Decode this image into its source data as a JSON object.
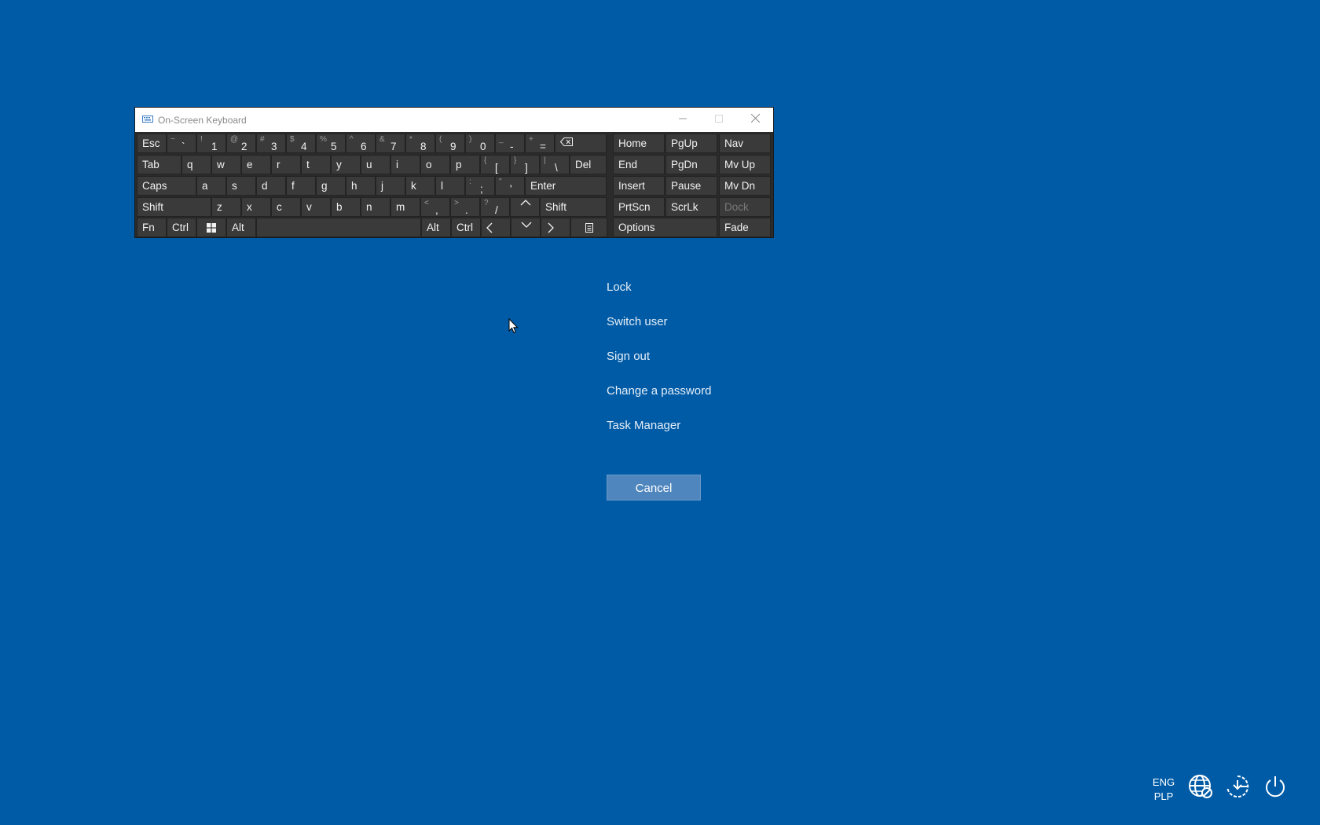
{
  "osk": {
    "title": "On-Screen Keyboard",
    "title_icon": "keyboard-icon",
    "controls": [
      "minimize-icon",
      "maximize-icon",
      "close-icon"
    ],
    "rows": [
      [
        {
          "id": "esc",
          "label": "Esc"
        },
        {
          "id": "tilde",
          "shift": "~",
          "base": "`"
        },
        {
          "id": "1",
          "shift": "!",
          "base": "1"
        },
        {
          "id": "2",
          "shift": "@",
          "base": "2"
        },
        {
          "id": "3",
          "shift": "#",
          "base": "3"
        },
        {
          "id": "4",
          "shift": "$",
          "base": "4"
        },
        {
          "id": "5",
          "shift": "%",
          "base": "5"
        },
        {
          "id": "6",
          "shift": "^",
          "base": "6"
        },
        {
          "id": "7",
          "shift": "&",
          "base": "7"
        },
        {
          "id": "8",
          "shift": "*",
          "base": "8"
        },
        {
          "id": "9",
          "shift": "(",
          "base": "9"
        },
        {
          "id": "0",
          "shift": ")",
          "base": "0"
        },
        {
          "id": "minus",
          "shift": "_",
          "base": "-"
        },
        {
          "id": "equals",
          "shift": "+",
          "base": "="
        },
        {
          "id": "backspace",
          "icon": "backspace-icon"
        }
      ],
      [
        {
          "id": "tab",
          "label": "Tab"
        },
        {
          "id": "q",
          "label": "q"
        },
        {
          "id": "w",
          "label": "w"
        },
        {
          "id": "e",
          "label": "e"
        },
        {
          "id": "r",
          "label": "r"
        },
        {
          "id": "t",
          "label": "t"
        },
        {
          "id": "y",
          "label": "y"
        },
        {
          "id": "u",
          "label": "u"
        },
        {
          "id": "i",
          "label": "i"
        },
        {
          "id": "o",
          "label": "o"
        },
        {
          "id": "p",
          "label": "p"
        },
        {
          "id": "lbracket",
          "shift": "{",
          "base": "["
        },
        {
          "id": "rbracket",
          "shift": "}",
          "base": "]"
        },
        {
          "id": "backslash",
          "shift": "|",
          "base": "\\"
        },
        {
          "id": "del",
          "label": "Del"
        }
      ],
      [
        {
          "id": "caps",
          "label": "Caps"
        },
        {
          "id": "a",
          "label": "a"
        },
        {
          "id": "s",
          "label": "s"
        },
        {
          "id": "d",
          "label": "d"
        },
        {
          "id": "f",
          "label": "f"
        },
        {
          "id": "g",
          "label": "g"
        },
        {
          "id": "h",
          "label": "h"
        },
        {
          "id": "j",
          "label": "j"
        },
        {
          "id": "k",
          "label": "k"
        },
        {
          "id": "l",
          "label": "l"
        },
        {
          "id": "semicolon",
          "shift": ":",
          "base": ";"
        },
        {
          "id": "quote",
          "shift": "\"",
          "base": "'"
        },
        {
          "id": "enter",
          "label": "Enter"
        }
      ],
      [
        {
          "id": "lshift",
          "label": "Shift"
        },
        {
          "id": "z",
          "label": "z"
        },
        {
          "id": "x",
          "label": "x"
        },
        {
          "id": "c",
          "label": "c"
        },
        {
          "id": "v",
          "label": "v"
        },
        {
          "id": "b",
          "label": "b"
        },
        {
          "id": "n",
          "label": "n"
        },
        {
          "id": "m",
          "label": "m"
        },
        {
          "id": "comma",
          "shift": "<",
          "base": ","
        },
        {
          "id": "period",
          "shift": ">",
          "base": "."
        },
        {
          "id": "slash",
          "shift": "?",
          "base": "/"
        },
        {
          "id": "up",
          "icon": "chevron-up-icon"
        },
        {
          "id": "rshift",
          "label": "Shift"
        }
      ],
      [
        {
          "id": "fn",
          "label": "Fn"
        },
        {
          "id": "lctrl",
          "label": "Ctrl"
        },
        {
          "id": "win",
          "icon": "windows-logo-icon"
        },
        {
          "id": "lalt",
          "label": "Alt"
        },
        {
          "id": "space",
          "label": ""
        },
        {
          "id": "ralt",
          "label": "Alt"
        },
        {
          "id": "rctrl",
          "label": "Ctrl"
        },
        {
          "id": "left",
          "icon": "chevron-left-icon"
        },
        {
          "id": "down",
          "icon": "chevron-down-icon"
        },
        {
          "id": "right",
          "icon": "chevron-right-icon"
        },
        {
          "id": "menu",
          "icon": "context-menu-icon"
        }
      ]
    ],
    "nav_rows": [
      [
        {
          "id": "home",
          "label": "Home"
        },
        {
          "id": "pgup",
          "label": "PgUp"
        },
        {
          "id": "nav",
          "label": "Nav"
        }
      ],
      [
        {
          "id": "end",
          "label": "End"
        },
        {
          "id": "pgdn",
          "label": "PgDn"
        },
        {
          "id": "mvup",
          "label": "Mv Up"
        }
      ],
      [
        {
          "id": "insert",
          "label": "Insert"
        },
        {
          "id": "pause",
          "label": "Pause"
        },
        {
          "id": "mvdn",
          "label": "Mv Dn"
        }
      ],
      [
        {
          "id": "prtscn",
          "label": "PrtScn"
        },
        {
          "id": "scrlk",
          "label": "ScrLk"
        },
        {
          "id": "dock",
          "label": "Dock",
          "disabled": true
        }
      ],
      [
        {
          "id": "options",
          "label": "Options"
        },
        {
          "id": "fade",
          "label": "Fade"
        }
      ]
    ]
  },
  "security_menu": {
    "items": [
      "Lock",
      "Switch user",
      "Sign out",
      "Change a password",
      "Task Manager"
    ],
    "cancel_label": "Cancel"
  },
  "tray": {
    "lang_line1": "ENG",
    "lang_line2": "PLP",
    "icons": [
      "network-icon",
      "ease-of-access-icon",
      "power-icon"
    ]
  },
  "colors": {
    "background": "#005ba6",
    "key_bg": "#3a3a3a",
    "cancel_bg": "#4f86bd"
  }
}
